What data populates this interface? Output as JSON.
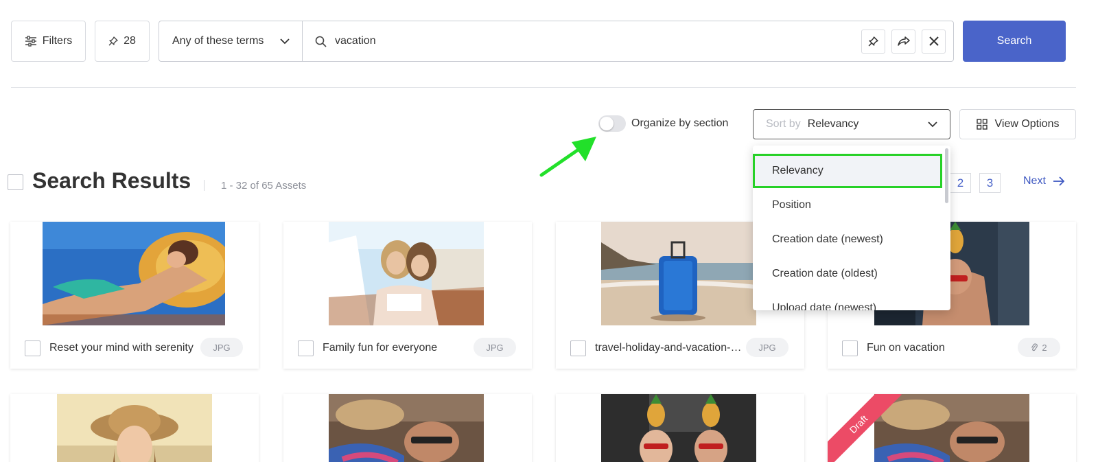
{
  "toolbar": {
    "filters_label": "Filters",
    "pinned_count": "28",
    "terms_mode": "Any of these terms",
    "search_value": "vacation",
    "search_button": "Search"
  },
  "controls": {
    "organize_label": "Organize by section",
    "organize_on": false,
    "sort_prefix": "Sort by",
    "sort_value": "Relevancy",
    "view_options": "View Options"
  },
  "sort_menu": {
    "items": [
      {
        "label": "Relevancy",
        "selected": true
      },
      {
        "label": "Position"
      },
      {
        "label": "Creation date (newest)"
      },
      {
        "label": "Creation date (oldest)"
      },
      {
        "label": "Upload date (newest)"
      }
    ]
  },
  "results": {
    "title": "Search Results",
    "count": "1 - 32 of 65 Assets",
    "pages": [
      "2",
      "3"
    ],
    "next_label": "Next"
  },
  "assets": [
    {
      "title": "Reset your mind with serenity",
      "badge": "JPG"
    },
    {
      "title": "Family fun for everyone",
      "badge": "JPG"
    },
    {
      "title": "travel-holiday-and-vacation-concept",
      "badge": "JPG"
    },
    {
      "title": "Fun on vacation",
      "badge": "2",
      "badge_icon": "paperclip-icon"
    }
  ],
  "assets_row2": [
    {
      "badge": null
    },
    {
      "badge": null
    },
    {
      "badge": null
    },
    {
      "ribbon": "Draft"
    }
  ],
  "colors": {
    "primary": "#4a64c9",
    "highlight": "#27d127",
    "ribbon": "#ec4b66"
  }
}
